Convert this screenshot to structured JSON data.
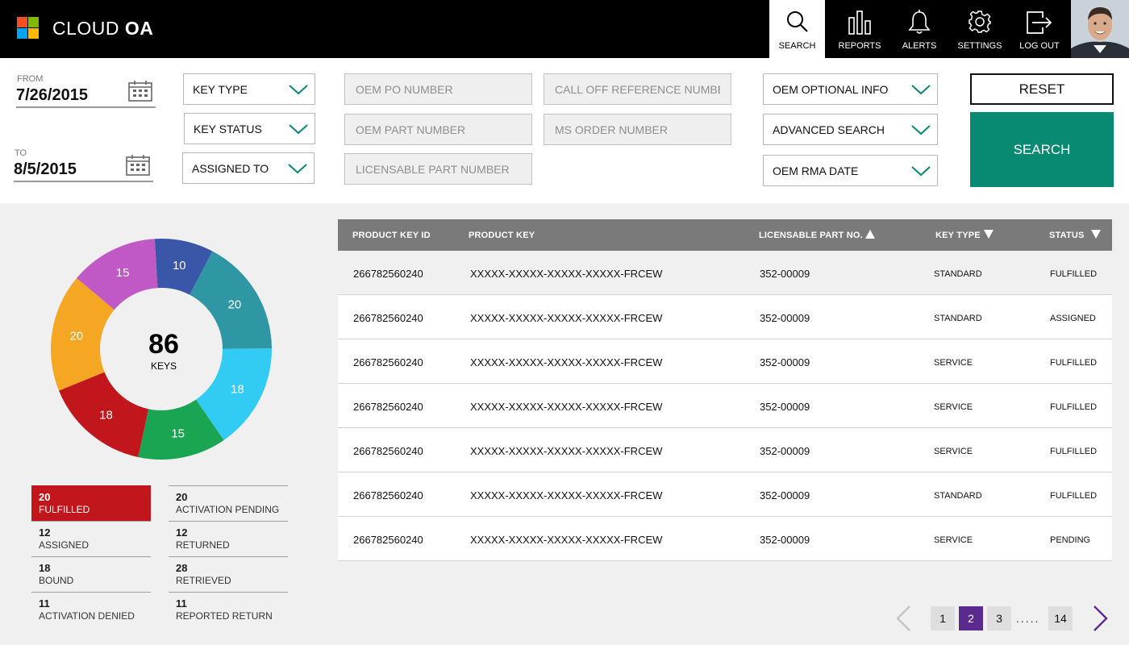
{
  "header": {
    "brand_prefix": "CLOUD ",
    "brand_bold": "OA",
    "nav": [
      {
        "label": "SEARCH",
        "icon": "search-icon",
        "active": true
      },
      {
        "label": "REPORTS",
        "icon": "reports-icon"
      },
      {
        "label": "ALERTS",
        "icon": "bell-icon"
      },
      {
        "label": "SETTINGS",
        "icon": "gear-icon"
      },
      {
        "label": "LOG OUT",
        "icon": "logout-icon"
      }
    ]
  },
  "filters": {
    "from_label": "FROM",
    "from_value": "7/26/2015",
    "to_label": "TO",
    "to_value": "8/5/2015",
    "dropdowns": {
      "key_type": "KEY TYPE",
      "key_status": "KEY STATUS",
      "assigned_to": "ASSIGNED TO",
      "oem_optional_info": "OEM OPTIONAL INFO",
      "advanced_search": "ADVANCED SEARCH",
      "oem_rma_date": "OEM RMA DATE"
    },
    "placeholders": {
      "oem_po_number": "OEM PO NUMBER",
      "oem_part_number": "OEM PART NUMBER",
      "licensable_part_number": "LICENSABLE PART NUMBER",
      "call_off_reference_number": "CALL OFF REFERENCE NUMBER",
      "ms_order_number": "MS ORDER NUMBER"
    },
    "reset_label": "RESET",
    "search_label": "SEARCH"
  },
  "summary": {
    "total": "86",
    "total_label": "KEYS",
    "donut_segments": [
      {
        "value": 10,
        "color": "#3a56a8"
      },
      {
        "value": 20,
        "color": "#2f96a4"
      },
      {
        "value": 18,
        "color": "#31cbf4"
      },
      {
        "value": 15,
        "color": "#1aa553"
      },
      {
        "value": 18,
        "color": "#c0161c"
      },
      {
        "value": 20,
        "color": "#f5a623"
      },
      {
        "value": 15,
        "color": "#c058c6"
      }
    ],
    "legend": [
      {
        "count": "20",
        "label": "FULFILLED",
        "selected": true
      },
      {
        "count": "20",
        "label": "ACTIVATION PENDING"
      },
      {
        "count": "12",
        "label": "ASSIGNED"
      },
      {
        "count": "12",
        "label": "RETURNED"
      },
      {
        "count": "18",
        "label": "BOUND"
      },
      {
        "count": "28",
        "label": "RETRIEVED"
      },
      {
        "count": "11",
        "label": "ACTIVATION DENIED"
      },
      {
        "count": "11",
        "label": "REPORTED RETURN"
      }
    ]
  },
  "table": {
    "columns": {
      "product_key_id": "PRODUCT KEY ID",
      "product_key": "PRODUCT KEY",
      "licensable_part_no": "LICENSABLE PART NO.",
      "key_type": "KEY TYPE",
      "status": "STATUS"
    },
    "rows": [
      {
        "id": "266782560240",
        "key": "XXXXX-XXXXX-XXXXX-XXXXX-FRCEW",
        "part": "352-00009",
        "type": "STANDARD",
        "status": "FULFILLED"
      },
      {
        "id": "266782560240",
        "key": "XXXXX-XXXXX-XXXXX-XXXXX-FRCEW",
        "part": "352-00009",
        "type": "STANDARD",
        "status": "ASSIGNED"
      },
      {
        "id": "266782560240",
        "key": "XXXXX-XXXXX-XXXXX-XXXXX-FRCEW",
        "part": "352-00009",
        "type": "SERVICE",
        "status": "FULFILLED"
      },
      {
        "id": "266782560240",
        "key": "XXXXX-XXXXX-XXXXX-XXXXX-FRCEW",
        "part": "352-00009",
        "type": "SERVICE",
        "status": "FULFILLED"
      },
      {
        "id": "266782560240",
        "key": "XXXXX-XXXXX-XXXXX-XXXXX-FRCEW",
        "part": "352-00009",
        "type": "SERVICE",
        "status": "FULFILLED"
      },
      {
        "id": "266782560240",
        "key": "XXXXX-XXXXX-XXXXX-XXXXX-FRCEW",
        "part": "352-00009",
        "type": "STANDARD",
        "status": "FULFILLED"
      },
      {
        "id": "266782560240",
        "key": "XXXXX-XXXXX-XXXXX-XXXXX-FRCEW",
        "part": "352-00009",
        "type": "SERVICE",
        "status": "PENDING"
      }
    ]
  },
  "pagination": {
    "pages": [
      "1",
      "2",
      "3"
    ],
    "current": "2",
    "ellipsis": ".....",
    "last": "14"
  }
}
